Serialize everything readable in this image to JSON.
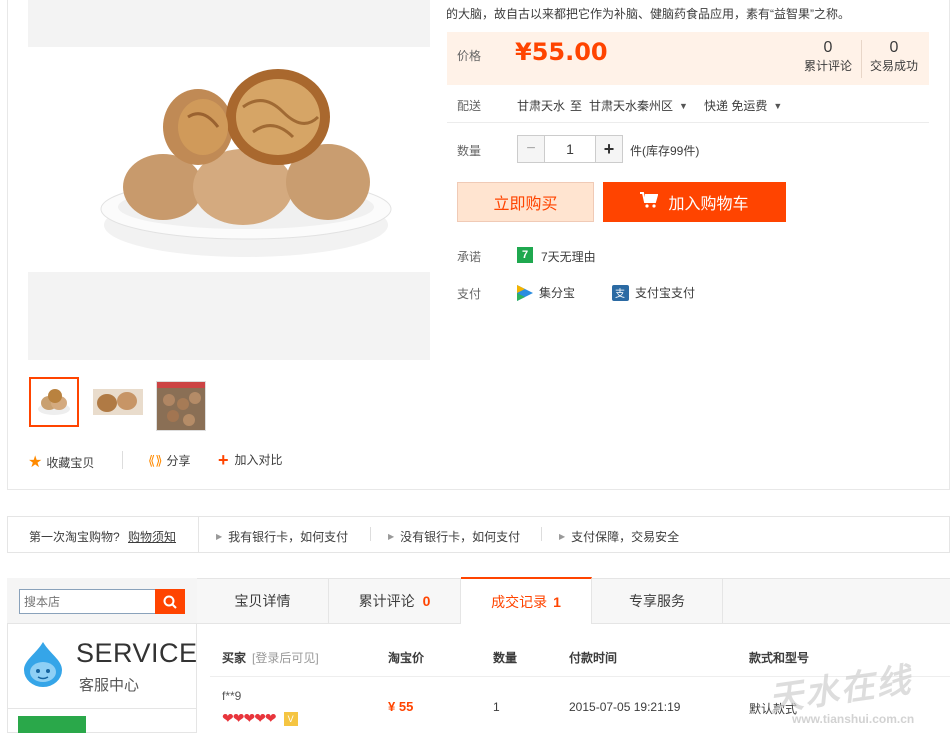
{
  "intro": {
    "line2": "的大脑，故自古以来都把它作为补脑、健脑药食品应用，素有“益智果”之称。"
  },
  "price": {
    "label": "价格",
    "value": "¥55.00",
    "stats": [
      {
        "num": "0",
        "label": "累计评论"
      },
      {
        "num": "0",
        "label": "交易成功"
      }
    ]
  },
  "delivery": {
    "label": "配送",
    "from": "甘肃天水",
    "to_word": "至",
    "to": "甘肃天水秦州区",
    "method": "快递 免运费"
  },
  "quantity": {
    "label": "数量",
    "minus": "−",
    "value": "1",
    "plus": "+",
    "stock": "件(库存99件)"
  },
  "actions": {
    "buy": "立即购买",
    "cart": "加入购物车"
  },
  "promise": {
    "label": "承诺",
    "badge": "7",
    "text": "7天无理由"
  },
  "payment": {
    "label": "支付",
    "options": [
      "集分宝",
      "支付宝支付"
    ]
  },
  "item_actions": {
    "favorite": "收藏宝贝",
    "share": "分享",
    "compare": "加入对比"
  },
  "help_bar": {
    "first": "第一次淘宝购物?",
    "guide_link": "购物须知",
    "links": [
      "我有银行卡，如何支付",
      "没有银行卡，如何支付",
      "支付保障，交易安全"
    ]
  },
  "shop_search": {
    "placeholder": "搜本店"
  },
  "service": {
    "title": "SERVICE",
    "subtitle": "客服中心"
  },
  "tabs": [
    {
      "label": "宝贝详情",
      "count": ""
    },
    {
      "label": "累计评论",
      "count": "0"
    },
    {
      "label": "成交记录",
      "count": "1"
    },
    {
      "label": "专享服务",
      "count": ""
    }
  ],
  "records": {
    "headers": {
      "buyer": "买家",
      "buyer_note": "[登录后可见]",
      "price": "淘宝价",
      "qty": "数量",
      "time": "付款时间",
      "style": "款式和型号"
    },
    "rows": [
      {
        "buyer": "f**9",
        "price": "¥ 55",
        "qty": "1",
        "time": "2015-07-05 19:21:19",
        "style": "默认款式"
      }
    ]
  },
  "watermark": {
    "cn": "天水在线",
    "url": "www.tianshui.com.cn"
  },
  "colors": {
    "accent": "#ff4400",
    "price_bg": "#fff2e8"
  }
}
